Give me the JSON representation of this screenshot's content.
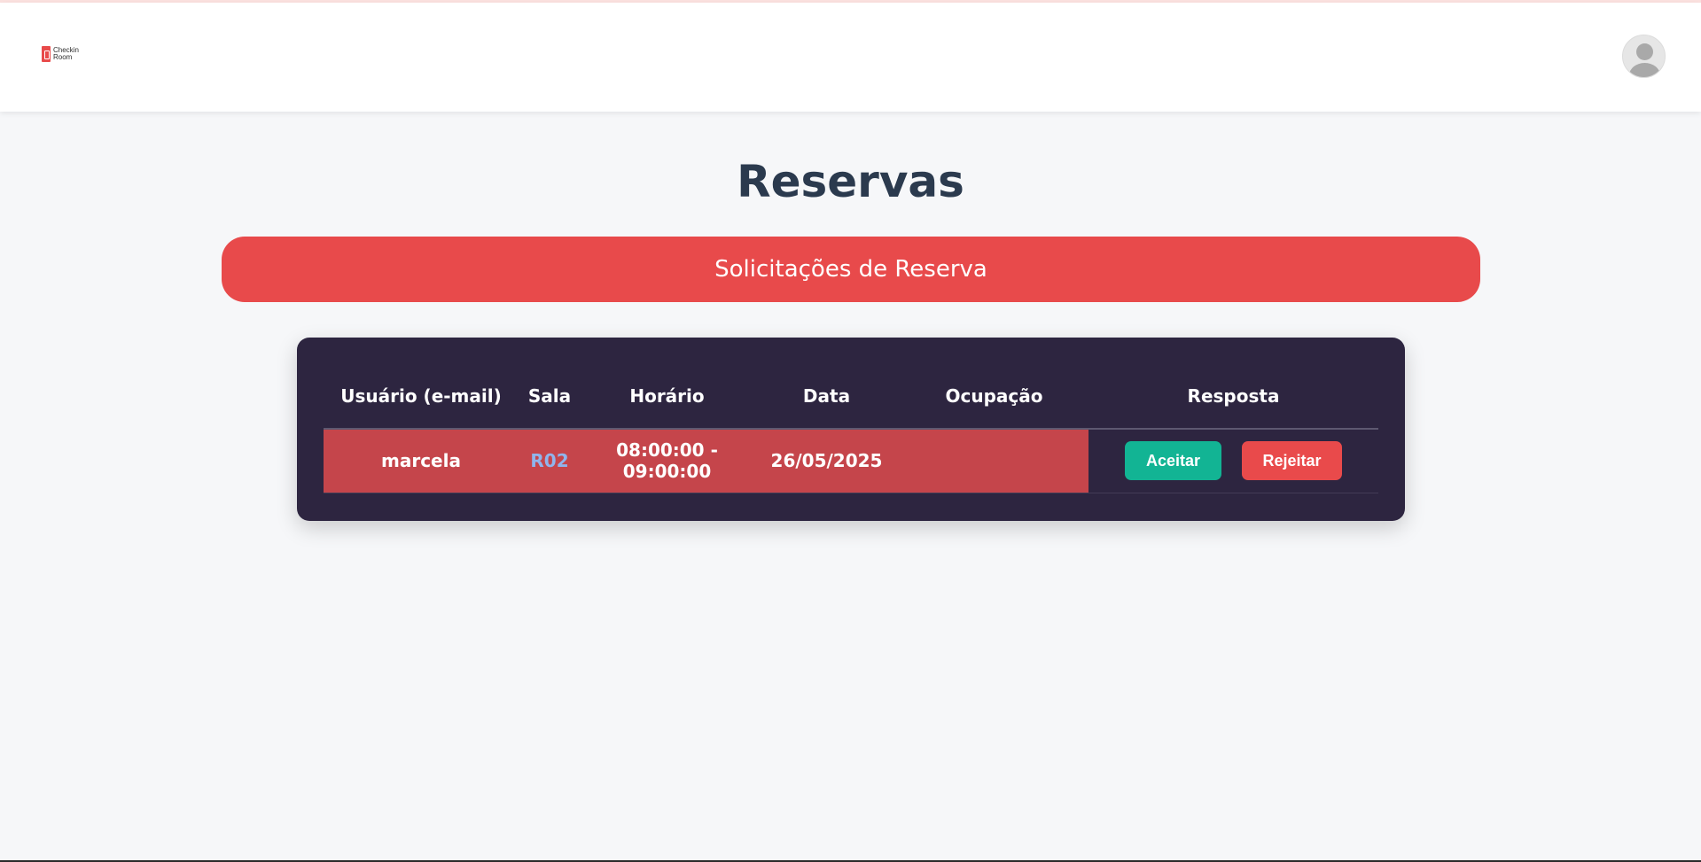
{
  "brand": {
    "logo_line1": "Checkin",
    "logo_line2": "Room"
  },
  "page": {
    "title": "Reservas",
    "section_title": "Solicitações de Reserva"
  },
  "table": {
    "headers": [
      "Usuário (e-mail)",
      "Sala",
      "Horário",
      "Data",
      "Ocupação",
      "Resposta"
    ],
    "rows": [
      {
        "user": "marcela",
        "room": "R02",
        "time": "08:00:00 - 09:00:00",
        "date": "26/05/2025",
        "occupancy": ""
      }
    ],
    "accept_label": "Aceitar",
    "reject_label": "Rejeitar"
  },
  "colors": {
    "brand_red": "#e84a4b",
    "table_bg": "#2d2540",
    "row_highlight": "#c5454b",
    "accept_green": "#12b494",
    "room_link": "#90b4ec"
  },
  "icons": {
    "avatar": "user-avatar-icon",
    "logo": "door-logo-icon"
  }
}
